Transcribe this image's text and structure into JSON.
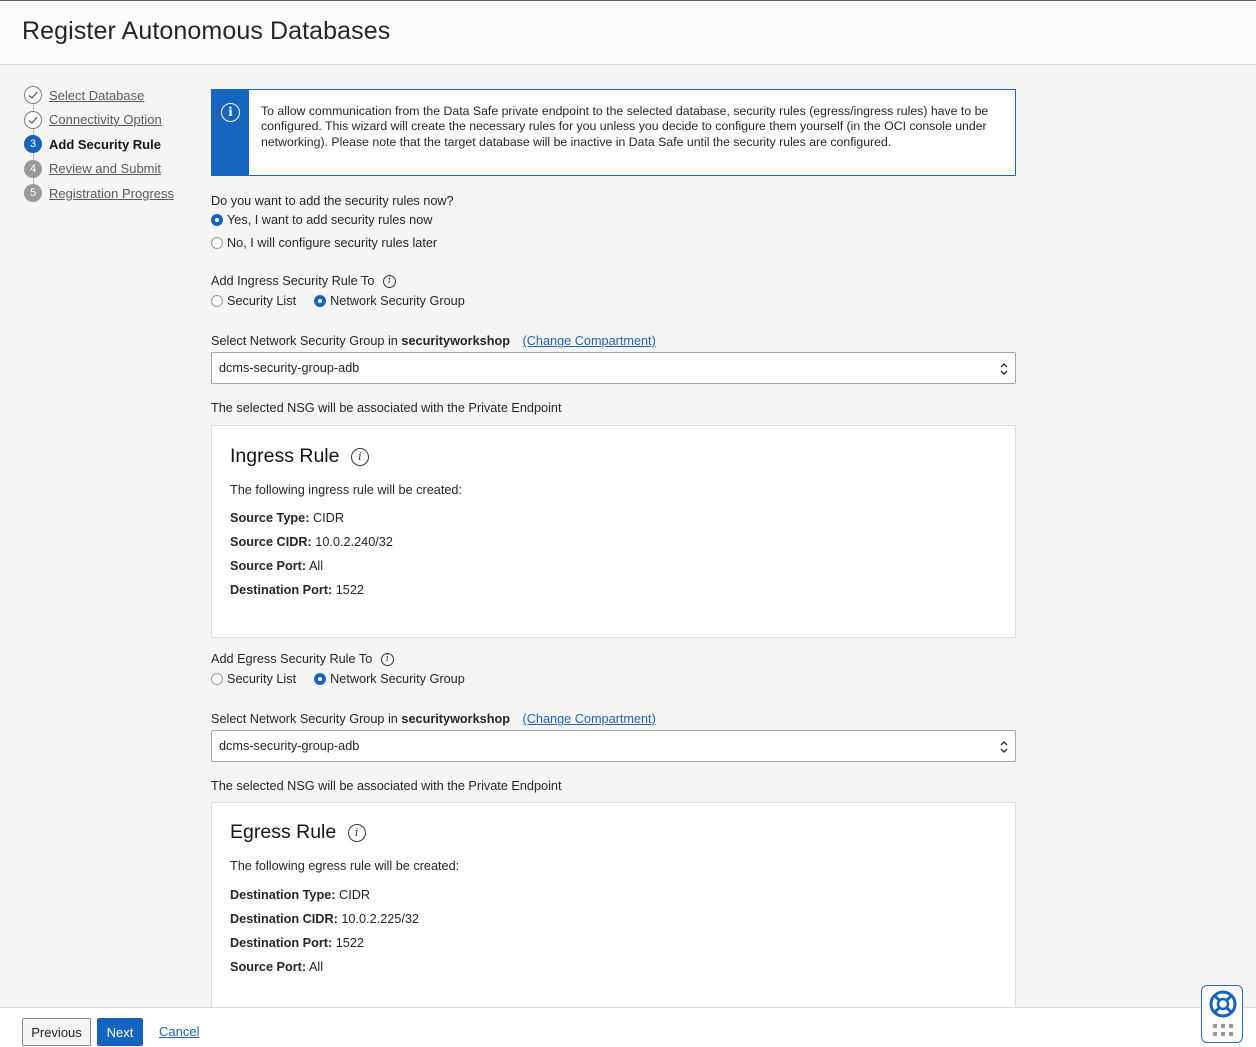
{
  "header": {
    "title": "Register Autonomous Databases"
  },
  "steps": [
    {
      "num": "",
      "label": "Select Database",
      "state": "done"
    },
    {
      "num": "",
      "label": "Connectivity Option",
      "state": "done"
    },
    {
      "num": "3",
      "label": "Add Security Rule",
      "state": "current"
    },
    {
      "num": "4",
      "label": "Review and Submit",
      "state": "todo"
    },
    {
      "num": "5",
      "label": "Registration Progress",
      "state": "todo"
    }
  ],
  "info": {
    "text": "To allow communication from the Data Safe private endpoint to the selected database, security rules (egress/ingress rules) have to be configured. This wizard will create the necessary rules for you unless you decide to configure them yourself (in the OCI console under networking). Please note that the target database will be inactive in Data Safe until the security rules are configured."
  },
  "add_now": {
    "question": "Do you want to add the security rules now?",
    "options": [
      "Yes, I want to add security rules now",
      "No, I will configure security rules later"
    ],
    "selected": 0
  },
  "ingress": {
    "add_to_label": "Add Ingress Security Rule To",
    "options": [
      "Security List",
      "Network Security Group"
    ],
    "selected": 1,
    "nsg_label_prefix": "Select Network Security Group in",
    "compartment": "securityworkshop",
    "change_link": "(Change Compartment)",
    "nsg_value": "dcms-security-group-adb",
    "nsg_note": "The selected NSG will be associated with the Private Endpoint",
    "card": {
      "title": "Ingress Rule",
      "intro": "The following ingress rule will be created:",
      "rows": [
        {
          "k": "Source Type:",
          "v": " CIDR"
        },
        {
          "k": "Source CIDR:",
          "v": " 10.0.2.240/32"
        },
        {
          "k": "Source Port:",
          "v": " All"
        },
        {
          "k": "Destination Port:",
          "v": " 1522"
        }
      ]
    }
  },
  "egress": {
    "add_to_label": "Add Egress Security Rule To",
    "options": [
      "Security List",
      "Network Security Group"
    ],
    "selected": 1,
    "nsg_label_prefix": "Select Network Security Group in",
    "compartment": "securityworkshop",
    "change_link": "(Change Compartment)",
    "nsg_value": "dcms-security-group-adb",
    "nsg_note": "The selected NSG will be associated with the Private Endpoint",
    "card": {
      "title": "Egress Rule",
      "intro": "The following egress rule will be created:",
      "rows": [
        {
          "k": "Destination Type:",
          "v": " CIDR"
        },
        {
          "k": "Destination CIDR:",
          "v": " 10.0.2.225/32"
        },
        {
          "k": "Destination Port:",
          "v": " 1522"
        },
        {
          "k": "Source Port:",
          "v": " All"
        }
      ]
    }
  },
  "footer": {
    "previous": "Previous",
    "next": "Next",
    "cancel": "Cancel"
  },
  "colors": {
    "accent": "#1564c0",
    "link": "#1f63b9"
  }
}
